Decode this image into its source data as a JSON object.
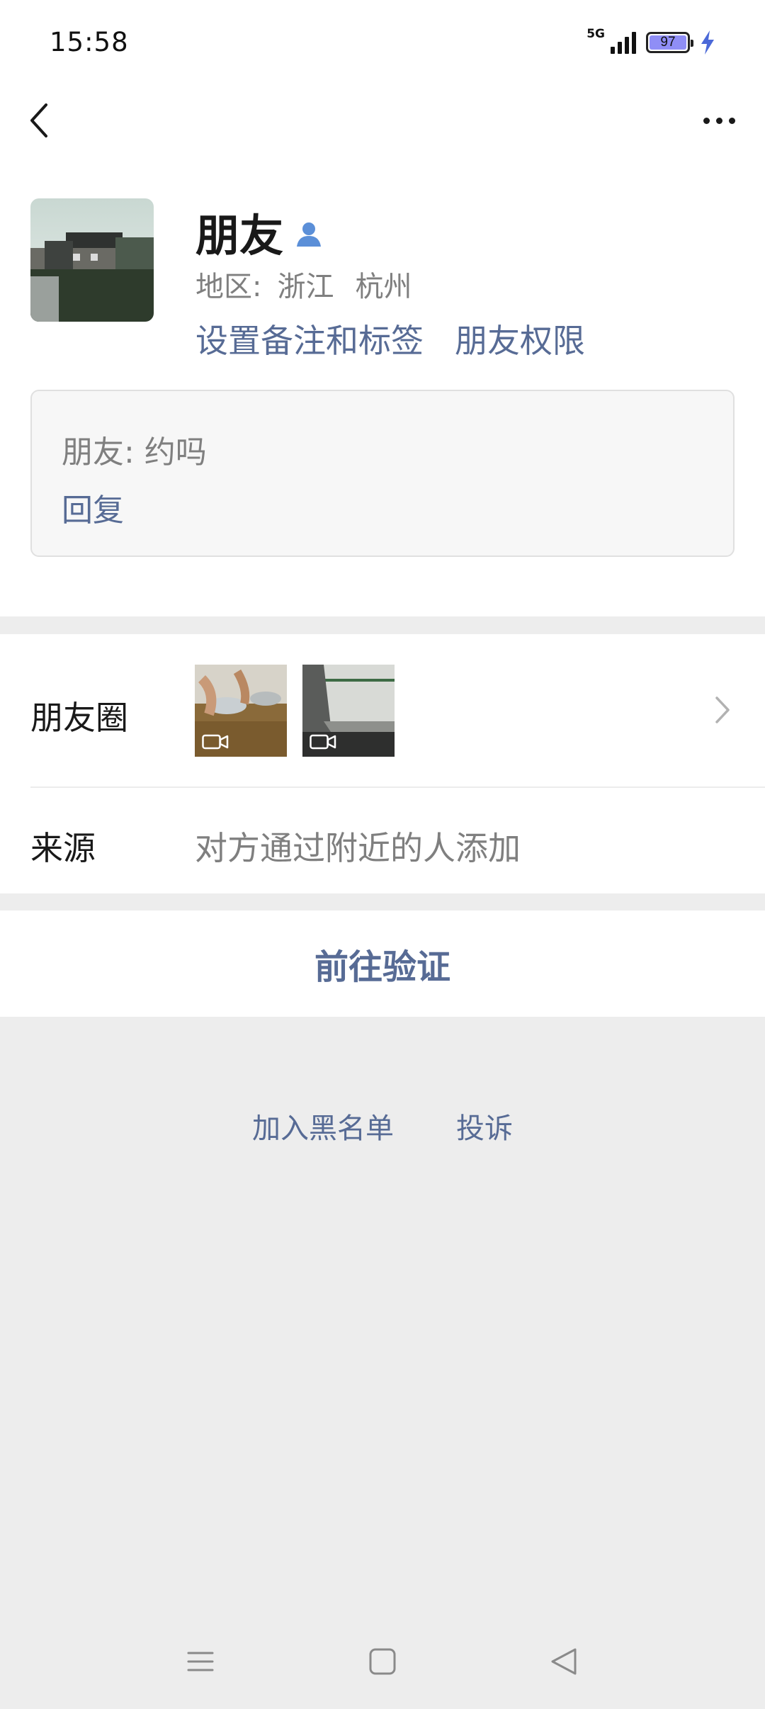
{
  "status_bar": {
    "time": "15:58",
    "network": "5G",
    "battery": "97",
    "battery_fill_color": "#8f8ef6",
    "charge_color": "#4b69d8"
  },
  "header": {
    "back_icon": "chevron-left-icon",
    "more_icon": "more-dots-icon"
  },
  "profile": {
    "name": "朋友",
    "gender_icon": "person-icon",
    "region_label": "地区:",
    "province": "浙江",
    "city": "杭州",
    "set_remark_label": "设置备注和标签",
    "permissions_label": "朋友权限"
  },
  "message": {
    "text": "朋友: 约吗",
    "reply_label": "回复"
  },
  "moments": {
    "label": "朋友圈",
    "thumbnails": [
      {
        "type": "video"
      },
      {
        "type": "video"
      }
    ]
  },
  "source": {
    "label": "来源",
    "value": "对方通过附近的人添加"
  },
  "actions": {
    "verify_label": "前往验证",
    "blacklist_label": "加入黑名单",
    "report_label": "投诉"
  },
  "colors": {
    "link": "#576b95",
    "background": "#ededed",
    "secondary_text": "#7f7f7f",
    "person_icon": "#5b8fd8"
  }
}
